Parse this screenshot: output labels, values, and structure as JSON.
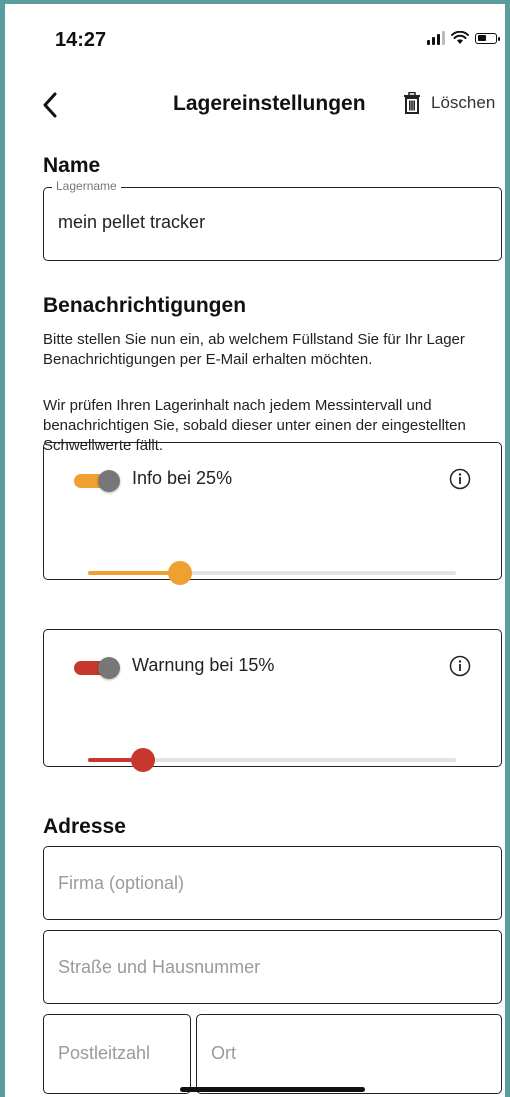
{
  "status_bar": {
    "time": "14:27",
    "icons": [
      "signal-icon",
      "wifi-icon",
      "battery-icon"
    ]
  },
  "nav": {
    "back_icon": "chevron-left-icon",
    "title": "Lagereinstellungen",
    "delete_icon": "trash-icon",
    "delete_label": "Löschen"
  },
  "name_section": {
    "title": "Name",
    "field": {
      "legend": "Lagername",
      "value": "mein pellet tracker"
    }
  },
  "notifications": {
    "title": "Benachrichtigungen",
    "intro": "Bitte stellen Sie nun ein, ab welchem Füllstand Sie für Ihr Lager Benachrichtigungen per E-Mail erhalten möchten.",
    "details": "Wir prüfen Ihren Lagerinhalt nach jedem Messintervall und benachrichtigen Sie, sobald dieser unter einen der eingestellten Schwellwerte fällt.",
    "thresholds": [
      {
        "label": "Info bei 25%",
        "enabled": true,
        "percent": 25,
        "color": "#f0a030",
        "icon": "info-icon"
      },
      {
        "label": "Warnung bei 15%",
        "enabled": true,
        "percent": 15,
        "color": "#c8372d",
        "icon": "info-icon"
      }
    ]
  },
  "address": {
    "title": "Adresse",
    "company_placeholder": "Firma (optional)",
    "street_placeholder": "Straße und Hausnummer",
    "zip_placeholder": "Postleitzahl",
    "city_placeholder": "Ort"
  },
  "colors": {
    "frame": "#5b9c9c",
    "info": "#f0a030",
    "warning": "#c8372d"
  }
}
